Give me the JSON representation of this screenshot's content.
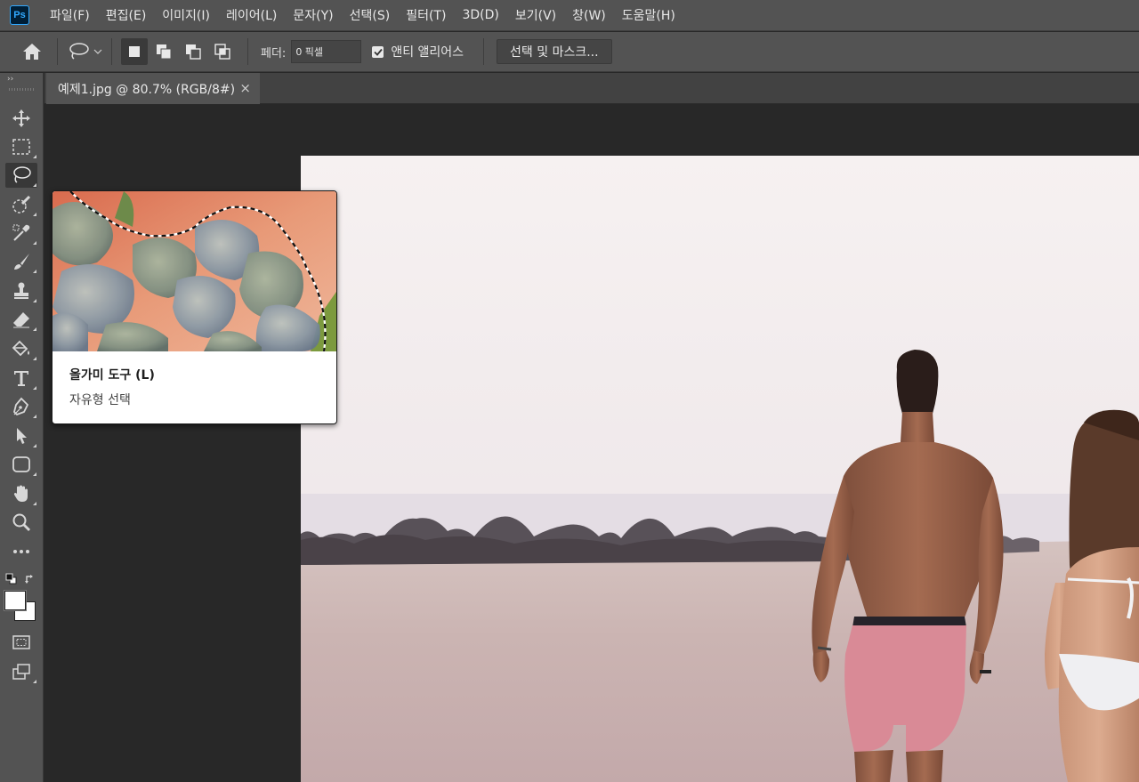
{
  "app": {
    "logo": "Ps",
    "menu": [
      "파일(F)",
      "편집(E)",
      "이미지(I)",
      "레이어(L)",
      "문자(Y)",
      "선택(S)",
      "필터(T)",
      "3D(D)",
      "보기(V)",
      "창(W)",
      "도움말(H)"
    ]
  },
  "options": {
    "home_icon": "home-icon",
    "feather_label": "페더:",
    "feather_value": "0 픽셀",
    "antialias_label": "앤티 앨리어스",
    "antialias_checked": true,
    "select_mask_label": "선택 및 마스크..."
  },
  "document": {
    "tab_title": "예제1.jpg @ 80.7% (RGB/8#)",
    "close_glyph": "×"
  },
  "toolbar": {
    "collapse_glyph": "››",
    "tools": [
      {
        "name": "move",
        "icon": "move-icon"
      },
      {
        "name": "marquee",
        "icon": "rect-marquee-icon"
      },
      {
        "name": "lasso",
        "icon": "lasso-icon",
        "active": true
      },
      {
        "name": "quick-select",
        "icon": "quick-select-icon"
      },
      {
        "name": "eyedropper",
        "icon": "eyedropper-icon"
      },
      {
        "name": "brush",
        "icon": "brush-icon"
      },
      {
        "name": "stamp",
        "icon": "clone-stamp-icon"
      },
      {
        "name": "eraser",
        "icon": "eraser-icon"
      },
      {
        "name": "paint-bucket",
        "icon": "paint-bucket-icon"
      },
      {
        "name": "type",
        "icon": "type-icon"
      },
      {
        "name": "pen",
        "icon": "pen-icon"
      },
      {
        "name": "path-select",
        "icon": "path-select-icon"
      },
      {
        "name": "shape",
        "icon": "rounded-rect-icon"
      },
      {
        "name": "hand",
        "icon": "hand-icon"
      },
      {
        "name": "zoom",
        "icon": "zoom-icon"
      },
      {
        "name": "more",
        "icon": "more-icon"
      }
    ],
    "foreground_color": "#ffffff",
    "background_color": "#ffffff"
  },
  "tooltip": {
    "title": "올가미 도구 (L)",
    "description": "자유형 선택"
  },
  "colors": {
    "panel": "#535353",
    "workspace": "#282828",
    "ps_blue": "#31a8ff"
  }
}
